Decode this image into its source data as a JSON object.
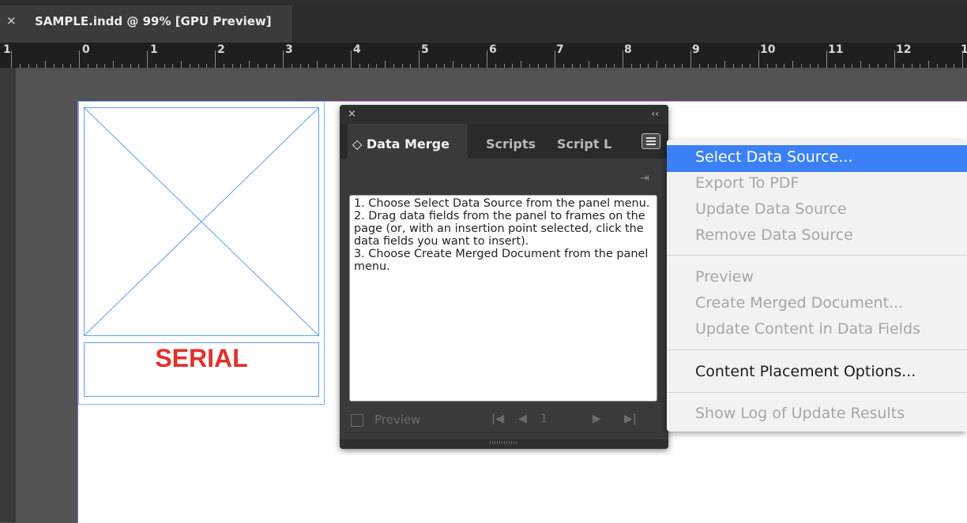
{
  "document": {
    "close_glyph": "×",
    "title": "SAMPLE.indd @ 99% [GPU Preview]"
  },
  "ruler": {
    "labels": [
      "1",
      "0",
      "1",
      "2",
      "3",
      "4",
      "5",
      "6",
      "7",
      "8",
      "9",
      "10",
      "11",
      "12",
      "1"
    ]
  },
  "page": {
    "serial_text": "SERIAL",
    "serial_color": "#e1302b",
    "frame_color": "#5fa0e8"
  },
  "panel": {
    "close_glyph": "×",
    "collapse_glyph": "‹‹",
    "tabs": [
      {
        "label": "◇ Data Merge",
        "active": true
      },
      {
        "label": "Scripts",
        "active": false
      },
      {
        "label": "Script L",
        "active": false
      }
    ],
    "instructions": [
      "1. Choose Select Data Source from the panel menu.",
      "2. Drag data fields from the panel to frames on the page (or, with an insertion point selected, click the data fields you want to insert).",
      "3. Choose Create Merged Document from the panel menu."
    ],
    "preview_label": "Preview",
    "record_number": "1",
    "nav_icons": [
      "first-record-icon",
      "previous-record-icon",
      "next-record-icon",
      "last-record-icon"
    ]
  },
  "menu": {
    "highlight_color": "#3b80f5",
    "items": [
      {
        "label": "Select Data Source...",
        "enabled": true,
        "highlighted": true
      },
      {
        "label": "Export To PDF",
        "enabled": false
      },
      {
        "label": "Update Data Source",
        "enabled": false
      },
      {
        "label": "Remove Data Source",
        "enabled": false
      },
      {
        "label": "Preview",
        "enabled": false
      },
      {
        "label": "Create Merged Document...",
        "enabled": false
      },
      {
        "label": "Update Content in Data Fields",
        "enabled": false
      },
      {
        "label": "Content Placement Options...",
        "enabled": true
      },
      {
        "label": "Show Log of Update Results",
        "enabled": false
      }
    ]
  }
}
